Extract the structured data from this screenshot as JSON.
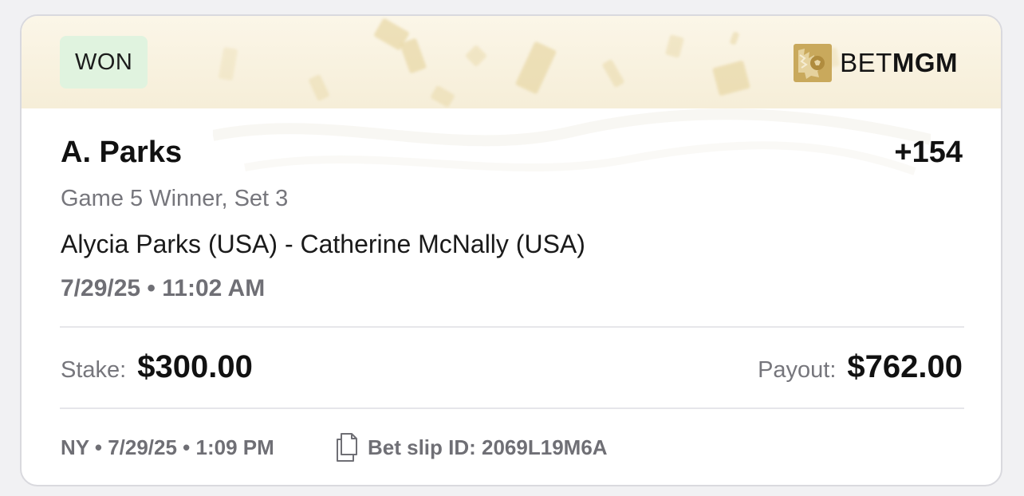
{
  "status": "WON",
  "brand": {
    "name_light": "BET",
    "name_bold": "MGM",
    "accent": "#c9a95c"
  },
  "bet": {
    "selection": "A. Parks",
    "odds": "+154",
    "market": "Game 5 Winner, Set 3",
    "event": "Alycia Parks (USA) - Catherine McNally (USA)",
    "event_time": "7/29/25 • 11:02 AM"
  },
  "amounts": {
    "stake_label": "Stake:",
    "stake_value": "$300.00",
    "payout_label": "Payout:",
    "payout_value": "$762.00"
  },
  "footer": {
    "placed": "NY • 7/29/25 • 1:09 PM",
    "bet_slip": "Bet slip ID: 2069L19M6A",
    "icon": "copy-document-icon"
  },
  "colors": {
    "won_badge_bg": "#e0f3df",
    "banner_bg": "#f6eed8",
    "muted_text": "#76767c"
  }
}
